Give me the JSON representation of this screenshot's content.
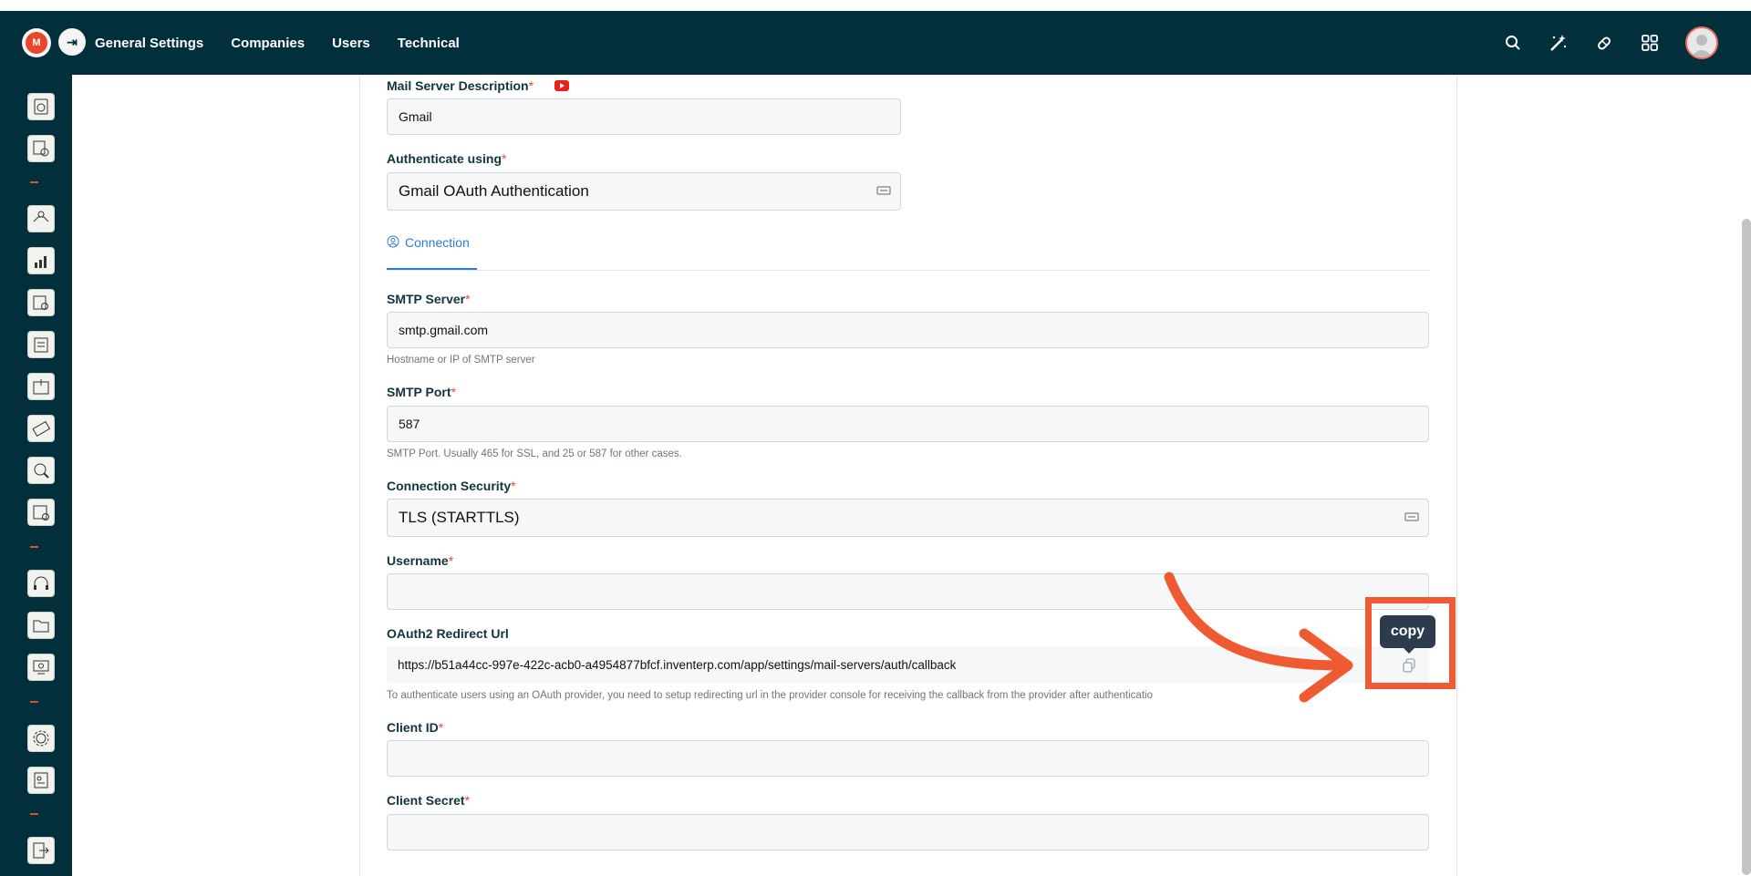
{
  "topbar": {
    "logo_text": "M",
    "nav": [
      "General Settings",
      "Companies",
      "Users",
      "Technical"
    ]
  },
  "form": {
    "mail_server_description": {
      "label": "Mail Server Description",
      "required": "*",
      "value": "Gmail"
    },
    "authenticate_using": {
      "label": "Authenticate using",
      "required": "*",
      "value": "Gmail OAuth Authentication"
    },
    "tab": {
      "label": "Connection"
    },
    "smtp_server": {
      "label": "SMTP Server",
      "required": "*",
      "value": "smtp.gmail.com",
      "hint": "Hostname or IP of SMTP server"
    },
    "smtp_port": {
      "label": "SMTP Port",
      "required": "*",
      "value": "587",
      "hint": "SMTP Port. Usually 465 for SSL, and 25 or 587 for other cases."
    },
    "connection_security": {
      "label": "Connection Security",
      "required": "*",
      "value": "TLS (STARTTLS)"
    },
    "username": {
      "label": "Username",
      "required": "*",
      "value": ""
    },
    "oauth2_redirect_url": {
      "label": "OAuth2 Redirect Url",
      "value": "https://b51a44cc-997e-422c-acb0-a4954877bfcf.inventerp.com/app/settings/mail-servers/auth/callback",
      "hint": "To authenticate users using an OAuth provider, you need to setup redirecting url in the provider console for receiving the callback from the provider after authenticatio"
    },
    "client_id": {
      "label": "Client ID",
      "required": "*",
      "value": ""
    },
    "client_secret": {
      "label": "Client Secret",
      "required": "*",
      "value": ""
    }
  },
  "copy_tooltip": "copy",
  "colors": {
    "topbar": "#012f3b",
    "accent": "#2b7bd6",
    "required": "#e8472b",
    "annotation": "#f05a32"
  }
}
